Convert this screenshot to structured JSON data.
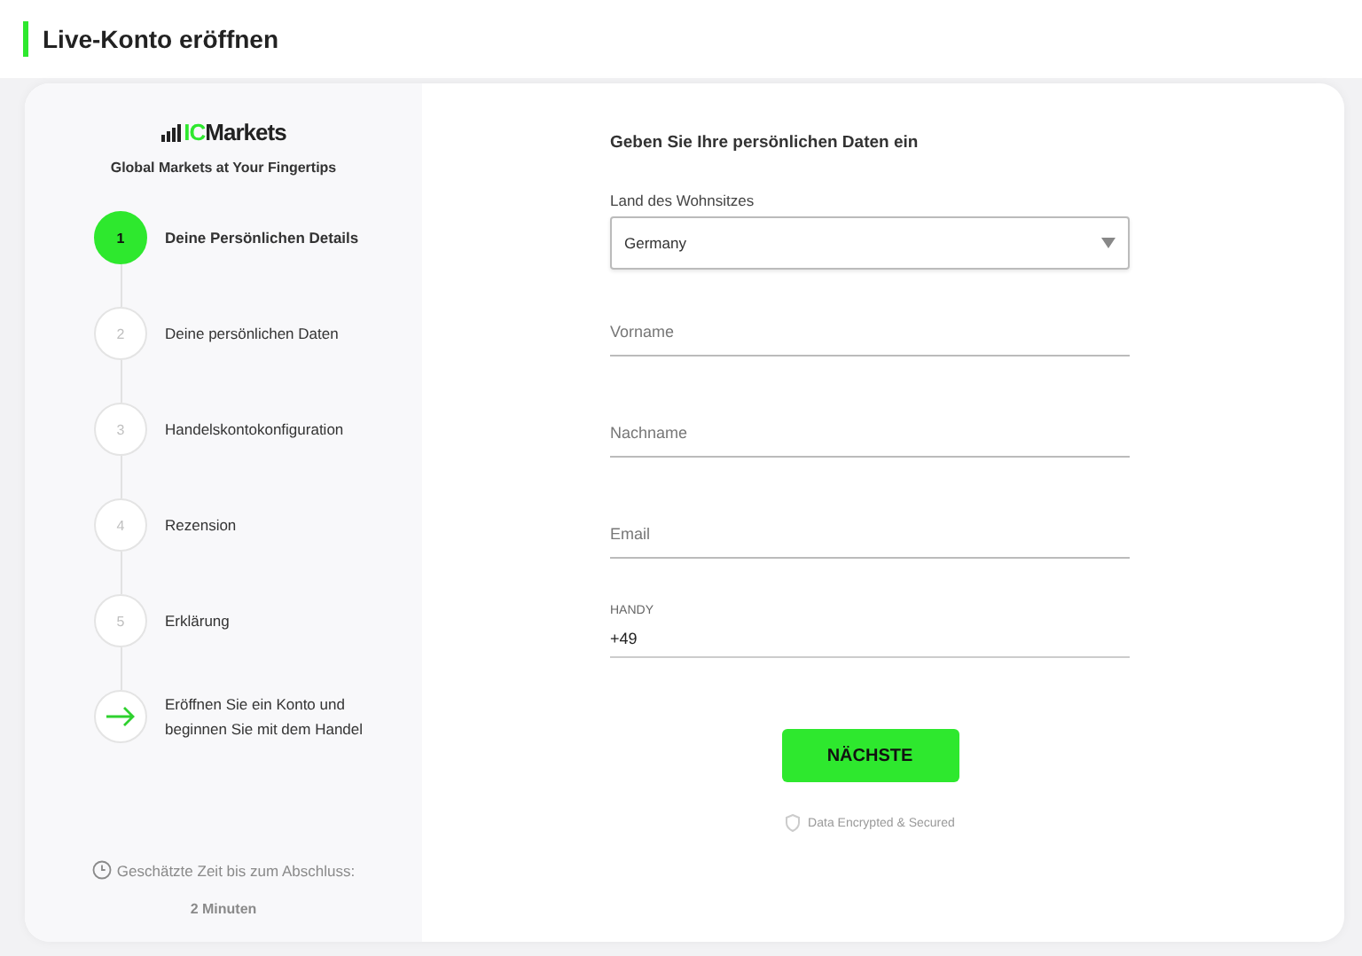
{
  "header": {
    "title": "Live-Konto eröffnen"
  },
  "brand": {
    "logo_accent": "IC",
    "logo_rest": "Markets",
    "tagline": "Global Markets at Your Fingertips"
  },
  "steps": [
    {
      "kind": "number",
      "marker": "1",
      "label": "Deine Persönlichen Details",
      "selected": true
    },
    {
      "kind": "number",
      "marker": "2",
      "label": "Deine persönlichen Daten",
      "selected": false
    },
    {
      "kind": "number",
      "marker": "3",
      "label": "Handelskontokonfiguration",
      "selected": false
    },
    {
      "kind": "number",
      "marker": "4",
      "label": "Rezension",
      "selected": false
    },
    {
      "kind": "number",
      "marker": "5",
      "label": "Erklärung",
      "selected": false
    },
    {
      "kind": "arrow",
      "label": "Eröffnen Sie ein Konto und beginnen Sie mit dem Handel",
      "selected": false
    }
  ],
  "estimate": {
    "label": "Geschätzte Zeit bis zum Abschluss:",
    "value": "2 Minuten"
  },
  "form": {
    "heading": "Geben Sie Ihre persönlichen Daten ein",
    "fields": [
      {
        "kind": "select",
        "label": "Land des Wohnsitzes",
        "value": "Germany"
      },
      {
        "kind": "text",
        "placeholder": "Vorname"
      },
      {
        "kind": "text",
        "placeholder": "Nachname"
      },
      {
        "kind": "text",
        "placeholder": "Email"
      },
      {
        "kind": "labeled",
        "label": "HANDY",
        "value": "+49"
      }
    ],
    "button": "NÄCHSTE",
    "security_note": "Data Encrypted & Secured"
  }
}
